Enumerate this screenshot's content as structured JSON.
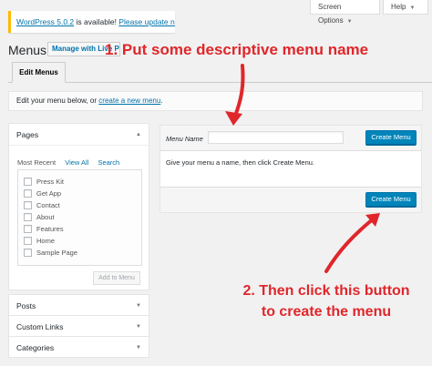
{
  "notice": {
    "version_text": "WordPress 5.0.2",
    "middle_text": " is available! ",
    "update_link": "Please update now",
    "end_text": "."
  },
  "screen_options": {
    "label": "Screen Options",
    "icon": "caret-down-icon"
  },
  "help": {
    "label": "Help",
    "icon": "caret-down-icon"
  },
  "header": {
    "title": "Menus",
    "manage_live": "Manage with Live Pre"
  },
  "tabs": {
    "edit_menus": "Edit Menus"
  },
  "manage_menus": {
    "prefix": "Edit your menu below, or ",
    "link": "create a new menu",
    "suffix": "."
  },
  "pages_box": {
    "title": "Pages",
    "tabs": [
      "Most Recent",
      "View All",
      "Search"
    ],
    "items": [
      "Press Kit",
      "Get App",
      "Contact",
      "About",
      "Features",
      "Home",
      "Sample Page"
    ],
    "add_button": "Add to Menu"
  },
  "side_sections": {
    "posts": "Posts",
    "custom_links": "Custom Links",
    "categories": "Categories"
  },
  "edit_panel": {
    "menu_name_label": "Menu Name",
    "menu_name_value": "",
    "create_button_top": "Create Menu",
    "body_text": "Give your menu a name, then click Create Menu.",
    "create_button_bottom": "Create Menu"
  },
  "annotations": {
    "step1": "1. Put some descriptive menu name",
    "step2_line1": "2. Then click this button",
    "step2_line2": "to create the menu"
  },
  "colors": {
    "accent": "#0085ba",
    "link": "#0073aa",
    "annotation": "#e0262b",
    "notice_border": "#ffb900"
  }
}
